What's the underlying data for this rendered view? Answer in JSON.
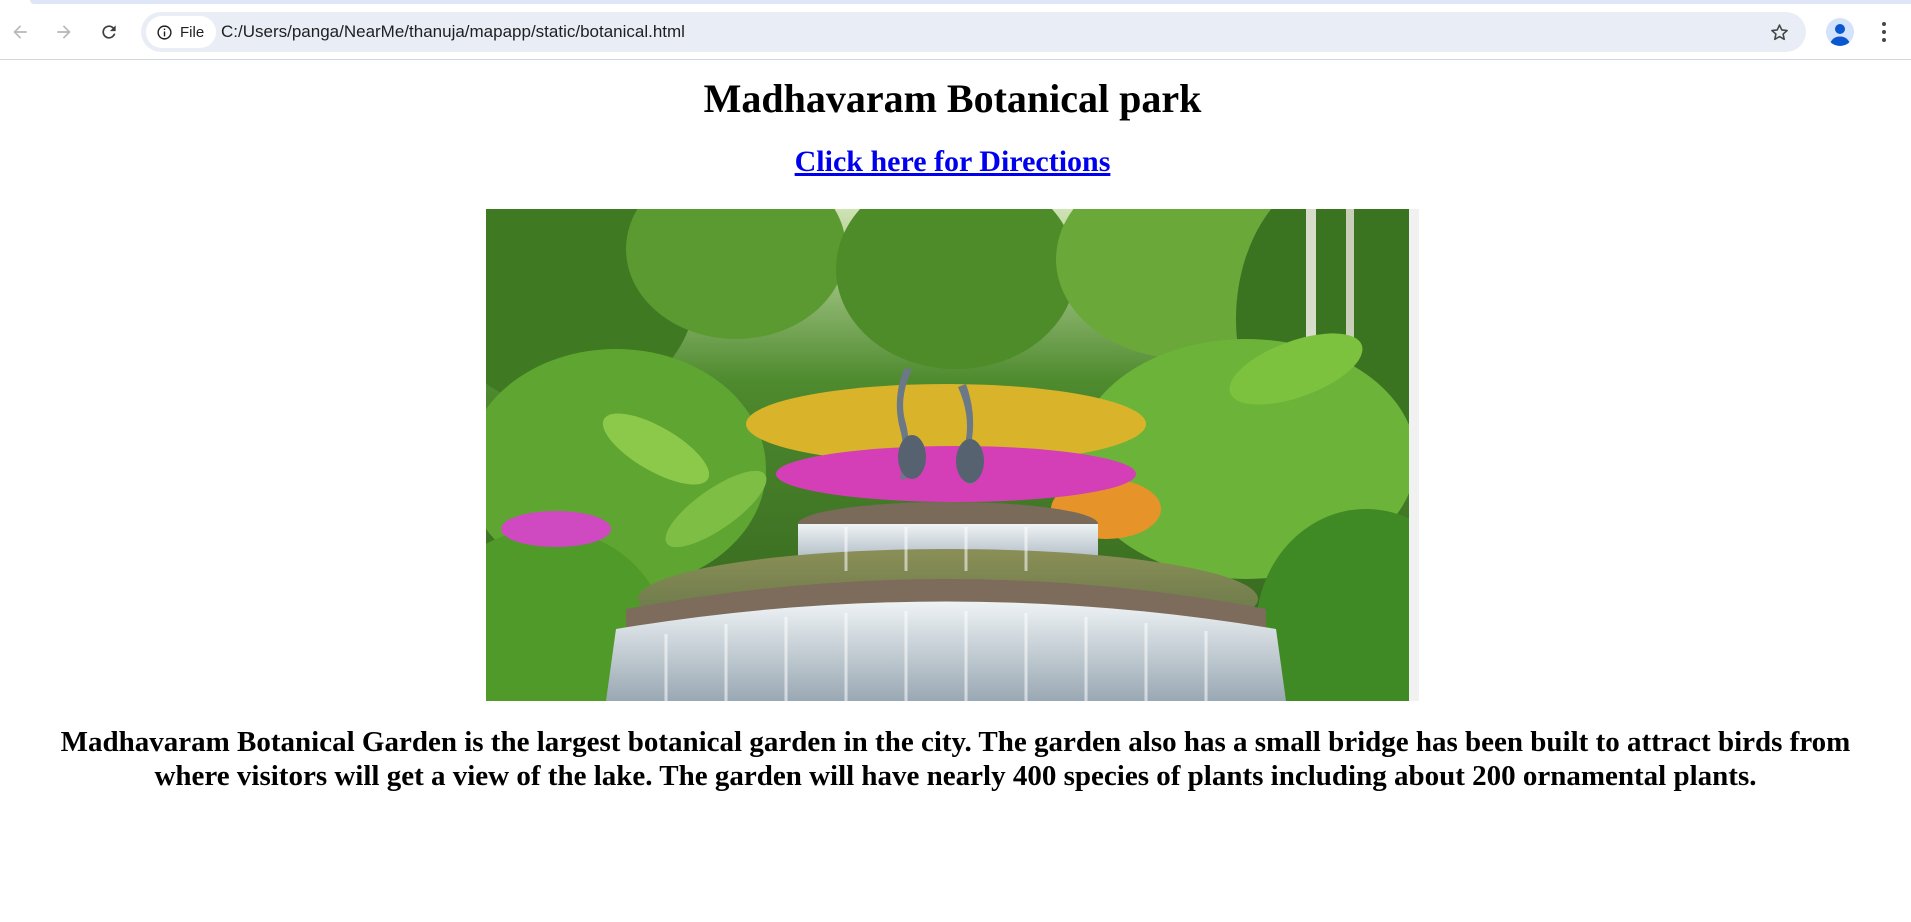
{
  "browser": {
    "back_icon": "arrow-left-icon",
    "forward_icon": "arrow-right-icon",
    "reload_icon": "reload-icon",
    "site_info_chip_label": "File",
    "url": "C:/Users/panga/NearMe/thanuja/mapapp/static/botanical.html",
    "bookmark_icon": "star-icon",
    "profile_icon": "person-icon",
    "menu_icon": "kebab-menu-icon"
  },
  "page": {
    "title": "Madhavaram Botanical park",
    "directions_link": "Click here for Directions",
    "image_subject": "garden-fountain-photo",
    "description": "Madhavaram Botanical Garden is the largest botanical garden in the city. The garden also has a small bridge has been built to attract birds from where visitors will get a view of the lake. The garden will have nearly 400 species of plants including about 200 ornamental plants."
  },
  "colors": {
    "link": "#0000ee",
    "omnibox_bg": "#e9eef6",
    "profile_bg": "#d3e3fd",
    "profile_fg": "#0b57d0"
  }
}
